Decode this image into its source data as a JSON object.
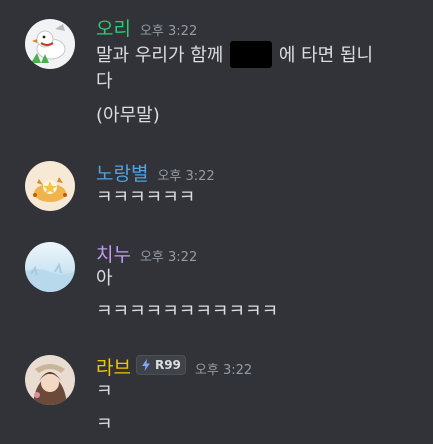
{
  "colors": {
    "background": "#313338",
    "text": "#dbdee1",
    "timestamp": "#949ba4",
    "spoiler": "#000000"
  },
  "messages": [
    {
      "author": "오리",
      "author_color": "#2ecc71",
      "timestamp": "오후 3:22",
      "avatar": "duck-avatar",
      "lines": [
        "말과 우리가 함께",
        "에 타면 됩니",
        "다",
        "(아무말)"
      ]
    },
    {
      "author": "노랑별",
      "author_color": "#4fa3e0",
      "timestamp": "오후 3:22",
      "avatar": "yellow-star-avatar",
      "lines": [
        "ㅋㅋㅋㅋㅋㅋ"
      ]
    },
    {
      "author": "치누",
      "author_color": "#c19cf0",
      "timestamp": "오후 3:22",
      "avatar": "sky-avatar",
      "lines": [
        "아",
        "ㅋㅋㅋㅋㅋㅋㅋㅋㅋㅋㅋ"
      ]
    },
    {
      "author": "라브",
      "author_color": "#f1c40f",
      "timestamp": "오후 3:22",
      "avatar": "girl-avatar",
      "badge": {
        "icon": "lightning-icon",
        "label": "R99"
      },
      "lines": [
        "ㅋ",
        "ㅋ"
      ]
    }
  ]
}
